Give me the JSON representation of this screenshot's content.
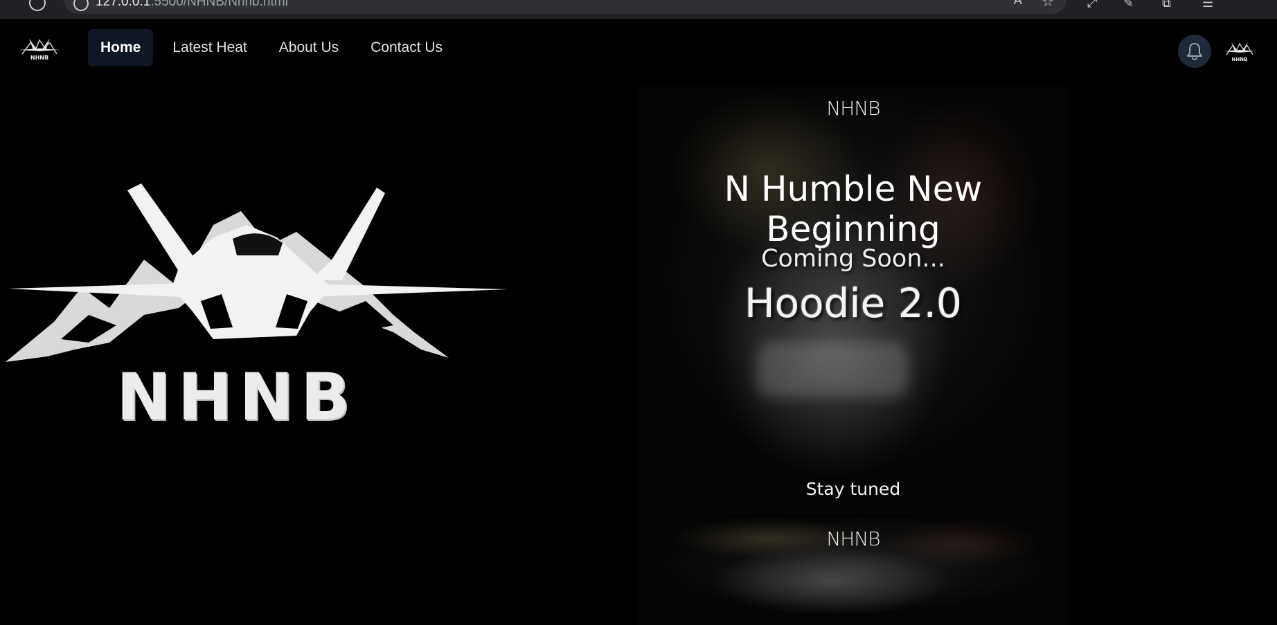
{
  "browser": {
    "url_host": "127.0.0.1",
    "url_rest": ":5500/NHNB/Nhnb.html"
  },
  "nav": {
    "logo_text": "NHNB",
    "links": [
      {
        "label": "Home",
        "active": true
      },
      {
        "label": "Latest Heat",
        "active": false
      },
      {
        "label": "About Us",
        "active": false
      },
      {
        "label": "Contact Us",
        "active": false
      }
    ],
    "bell_icon": "bell-icon",
    "avatar_text": "NHNB"
  },
  "hero": {
    "logo_text": "NHNB"
  },
  "promo": {
    "brand": "NHNB",
    "title": "N Humble New Beginning",
    "coming": "Coming Soon...",
    "product": "Hoodie 2.0",
    "stay": "Stay tuned"
  },
  "promo2": {
    "brand": "NHNB"
  },
  "colors": {
    "background": "#000000",
    "active_nav": "#0f1624",
    "bell_bg": "#1f2937"
  }
}
